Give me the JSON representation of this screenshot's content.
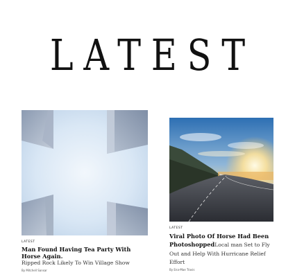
{
  "masthead": {
    "title": "LATEST"
  },
  "articles": [
    {
      "kicker": "LATEST",
      "headline": "Man Found Having Tea Party With Horse Again.",
      "dek": "Ripped Rock Likely To Win Village Show",
      "byline": "By Mitchell Sansar",
      "image_icon": "sky-between-buildings-photo"
    },
    {
      "kicker": "LATEST",
      "headline": "Viral Photo Of Horse Had Been Photoshopped",
      "dek": "Local man Set to Fly Out and Help With Hurricane Relief Effort",
      "byline": "By Ena-Mae Travis",
      "image_icon": "coastal-road-sunset-photo"
    }
  ]
}
